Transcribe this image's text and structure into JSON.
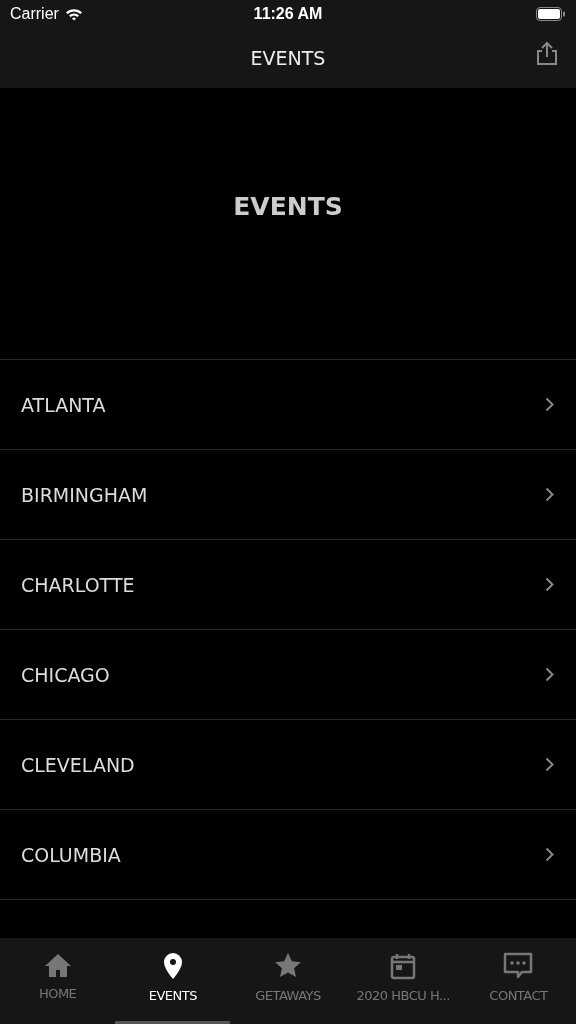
{
  "status_bar": {
    "carrier": "Carrier",
    "time": "11:26 AM"
  },
  "nav_bar": {
    "title": "EVENTS"
  },
  "header": {
    "title": "EVENTS"
  },
  "cities": [
    {
      "label": "ATLANTA"
    },
    {
      "label": "BIRMINGHAM"
    },
    {
      "label": "CHARLOTTE"
    },
    {
      "label": "CHICAGO"
    },
    {
      "label": "CLEVELAND"
    },
    {
      "label": "COLUMBIA"
    }
  ],
  "tabs": [
    {
      "label": "HOME",
      "kind": "home",
      "selected": false
    },
    {
      "label": "EVENTS",
      "kind": "pin",
      "selected": true
    },
    {
      "label": "GETAWAYS",
      "kind": "star",
      "selected": false
    },
    {
      "label": "2020 HBCU H...",
      "kind": "calendar",
      "selected": false
    },
    {
      "label": "CONTACT",
      "kind": "chat",
      "selected": false
    }
  ]
}
